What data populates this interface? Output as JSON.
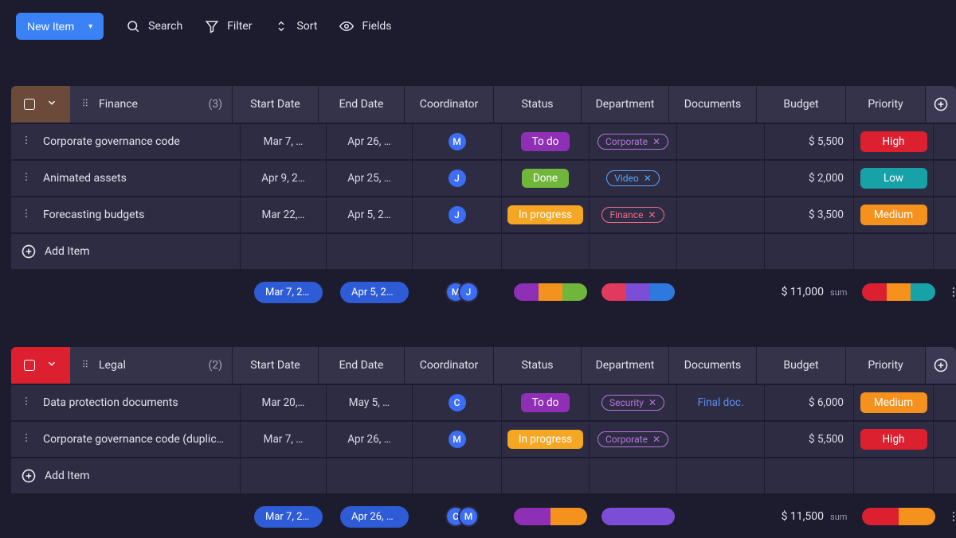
{
  "toolbar": {
    "newItem": "New Item",
    "search": "Search",
    "filter": "Filter",
    "sort": "Sort",
    "fields": "Fields"
  },
  "headers": {
    "startDate": "Start Date",
    "endDate": "End Date",
    "coordinator": "Coordinator",
    "status": "Status",
    "department": "Department",
    "documents": "Documents",
    "budget": "Budget",
    "priority": "Priority"
  },
  "groups": [
    {
      "name": "Finance",
      "count": "(3)",
      "accent": "brown",
      "rows": [
        {
          "title": "Corporate governance code",
          "start": "Mar 7, …",
          "end": "Apr 26, …",
          "coord": "M",
          "status": "To do",
          "statusClass": "todo",
          "dept": "Corporate",
          "deptClass": "corporate",
          "docs": "",
          "budget": "$ 5,500",
          "priority": "High",
          "prioClass": "high"
        },
        {
          "title": "Animated assets",
          "start": "Apr 9, 2…",
          "end": "Apr 25, …",
          "coord": "J",
          "status": "Done",
          "statusClass": "done",
          "dept": "Video",
          "deptClass": "video",
          "docs": "",
          "budget": "$ 2,000",
          "priority": "Low",
          "prioClass": "low"
        },
        {
          "title": "Forecasting budgets",
          "start": "Mar 22,…",
          "end": "Apr 5, 2…",
          "coord": "J",
          "status": "In progress",
          "statusClass": "progress",
          "dept": "Finance",
          "deptClass": "finance",
          "docs": "",
          "budget": "$ 3,500",
          "priority": "Medium",
          "prioClass": "medium"
        }
      ],
      "addItem": "Add Item",
      "summary": {
        "start": "Mar 7, 20…",
        "end": "Apr 5, 20…",
        "coords": [
          "M",
          "J"
        ],
        "statusSegs": [
          "seg-purple",
          "seg-orange",
          "seg-green"
        ],
        "deptSegs": [
          "seg-red",
          "seg-purple2",
          "seg-blue"
        ],
        "budget": "$ 11,000",
        "budgetLabel": "sum",
        "prioSegs": [
          "seg-red2",
          "seg-orange",
          "seg-teal"
        ]
      }
    },
    {
      "name": "Legal",
      "count": "(2)",
      "accent": "red",
      "rows": [
        {
          "title": "Data protection documents",
          "start": "Mar 20,…",
          "end": "May 5, …",
          "coord": "C",
          "status": "To do",
          "statusClass": "todo",
          "dept": "Security",
          "deptClass": "security",
          "docs": "Final doc.",
          "budget": "$ 6,000",
          "priority": "Medium",
          "prioClass": "medium"
        },
        {
          "title": "Corporate governance code (duplic…",
          "start": "Mar 7, …",
          "end": "Apr 26, …",
          "coord": "M",
          "status": "In progress",
          "statusClass": "progress",
          "dept": "Corporate",
          "deptClass": "corporate",
          "docs": "",
          "budget": "$ 5,500",
          "priority": "High",
          "prioClass": "high"
        }
      ],
      "addItem": "Add Item",
      "summary": {
        "start": "Mar 7, 20…",
        "end": "Apr 26, 2…",
        "coords": [
          "C",
          "M"
        ],
        "statusSegs": [
          "seg-purple",
          "seg-orange"
        ],
        "deptSegs": [
          "seg-purple2",
          "seg-purple2"
        ],
        "budget": "$ 11,500",
        "budgetLabel": "sum",
        "prioSegs": [
          "seg-red2",
          "seg-orange"
        ]
      }
    }
  ]
}
